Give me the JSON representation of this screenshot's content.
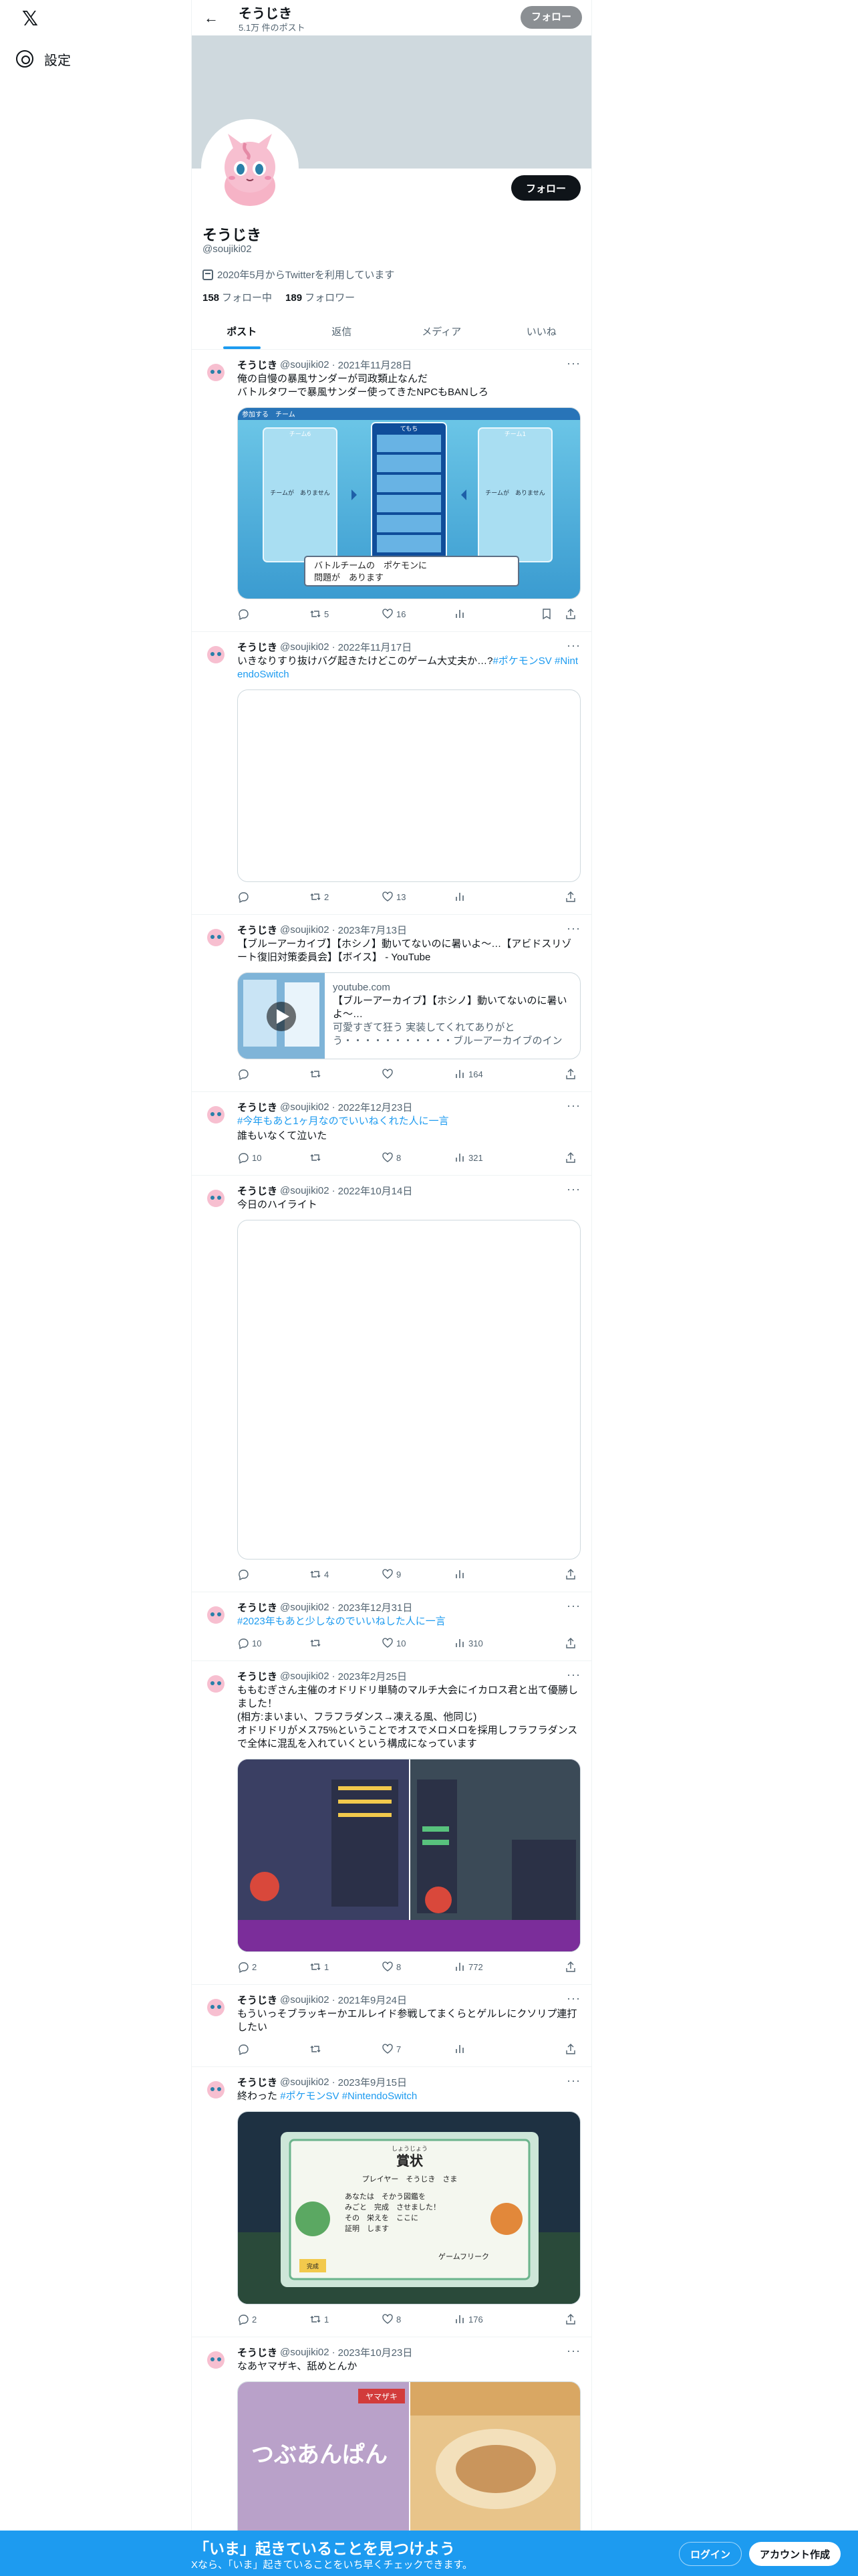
{
  "nav": {
    "settings_label": "設定"
  },
  "profile": {
    "top_name": "そうじき",
    "post_count": "5.1万 件のポスト",
    "top_follow": "フォロー",
    "follow": "フォロー",
    "name": "そうじき",
    "handle": "@soujiki02",
    "joined": "2020年5月からTwitterを利用しています",
    "following_count": "158",
    "following_label": "フォロー中",
    "followers_count": "189",
    "followers_label": "フォロワー"
  },
  "tabs": [
    "ポスト",
    "返信",
    "メディア",
    "いいね"
  ],
  "tweets": [
    {
      "name": "そうじき",
      "handle": "@soujiki02",
      "date": "2021年11月28日",
      "text": "俺の自慢の暴風サンダーが司政類止なんだ\nバトルタワーで暴風サンダー使ってきたNPCもBANしろ",
      "reply": "",
      "rt": "5",
      "like": "16",
      "views": "",
      "media": {
        "header_left": "参加する　チーム",
        "team_left": "チーム6",
        "team_mid": "てもち",
        "team_right": "チーム1",
        "empty_left": "チームが　ありません",
        "empty_right": "チームが　ありません",
        "msg_line1": "バトルチームの　ポケモンに",
        "msg_line2": "問題が　あります"
      }
    },
    {
      "name": "そうじき",
      "handle": "@soujiki02",
      "date": "2022年11月17日",
      "text": "いきなりすり抜けバグ起きたけどこのゲーム大丈夫か…?",
      "hashtags": "#ポケモンSV #NintendoSwitch",
      "reply": "",
      "rt": "2",
      "like": "13",
      "views": ""
    },
    {
      "name": "そうじき",
      "handle": "@soujiki02",
      "date": "2023年7月13日",
      "text": "【ブルーアーカイブ】【ホシノ】動いてないのに暑いよ〜…【アビドスリゾート復旧対策委員会】【ボイス】 - YouTube",
      "reply": "",
      "rt": "",
      "like": "",
      "views": "164",
      "card": {
        "domain": "youtube.com",
        "title": "【ブルーアーカイブ】【ホシノ】動いてないのに暑いよ〜…",
        "desc": "可愛すぎて狂う 実装してくれてありがとう・・・・・・・・・・・ブルーアーカイブのインストールは..."
      }
    },
    {
      "name": "そうじき",
      "handle": "@soujiki02",
      "date": "2022年12月23日",
      "hashtag_line": "#今年もあと1ヶ月なのでいいねくれた人に一言",
      "text": "誰もいなくて泣いた",
      "reply": "10",
      "rt": "",
      "like": "8",
      "views": "321"
    },
    {
      "name": "そうじき",
      "handle": "@soujiki02",
      "date": "2022年10月14日",
      "text": "今日のハイライト",
      "reply": "",
      "rt": "4",
      "like": "9",
      "views": ""
    },
    {
      "name": "そうじき",
      "handle": "@soujiki02",
      "date": "2023年12月31日",
      "hashtag_line": "#2023年もあと少しなのでいいねした人に一言",
      "text": "",
      "reply": "10",
      "rt": "",
      "like": "10",
      "views": "310"
    },
    {
      "name": "そうじき",
      "handle": "@soujiki02",
      "date": "2023年2月25日",
      "text": "ももむぎさん主催のオドリドリ単騎のマルチ大会にイカロス君と出て優勝しました！\n(相方:まいまい、フラフラダンス→凍える風、他同じ)\nオドリドリがメス75%ということでオスでメロメロを採用しフラフラダンスで全体に混乱を入れていくという構成になっています",
      "reply": "2",
      "rt": "1",
      "like": "8",
      "views": "772"
    },
    {
      "name": "そうじき",
      "handle": "@soujiki02",
      "date": "2021年9月24日",
      "text": "もういっそブラッキーかエルレイド参戦してまくらとゲルレにクソリプ連打したい",
      "reply": "",
      "rt": "",
      "like": "7",
      "views": ""
    },
    {
      "name": "そうじき",
      "handle": "@soujiki02",
      "date": "2023年9月15日",
      "text": "終わった",
      "hashtags": "#ポケモンSV #NintendoSwitch",
      "reply": "2",
      "rt": "1",
      "like": "8",
      "views": "176",
      "award": {
        "ruby": "しょうじょう",
        "title": "賞状",
        "player": "プレイヤー　そうじき　さま",
        "body": "あなたは　そかう図鑑を\nみごと　完成　させました！\nその　栄えを　ここに\n証明　します",
        "sign": "ゲームフリーク",
        "badge": "完成"
      }
    },
    {
      "name": "そうじき",
      "handle": "@soujiki02",
      "date": "2023年10月23日",
      "text": "なあヤマザキ、舐めとんか",
      "reply": "",
      "rt": "",
      "like": "",
      "views": "",
      "bread": {
        "label": "つぶあんぱん",
        "brand": "ヤマザキ"
      }
    }
  ],
  "bottom": {
    "title": "「いま」起きていることを見つけよう",
    "sub": "Xなら、「いま」起きていることをいち早くチェックできます。",
    "login": "ログイン",
    "signup": "アカウント作成"
  }
}
